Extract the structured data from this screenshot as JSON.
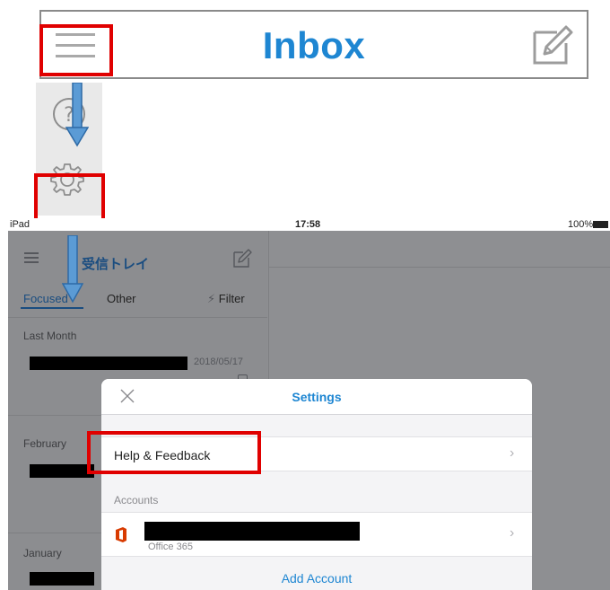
{
  "zoomed_header": {
    "title": "Inbox"
  },
  "ipad": {
    "status": {
      "device": "iPad",
      "time": "17:58",
      "battery": "100%"
    },
    "mail_list": {
      "title": "受信トレイ",
      "tabs": [
        {
          "label": "Focused"
        },
        {
          "label": "Other"
        }
      ],
      "filter_label": "Filter",
      "sections": [
        {
          "label": "Last Month",
          "date": "2018/05/17"
        },
        {
          "label": "February"
        },
        {
          "label": "January"
        }
      ]
    },
    "settings": {
      "title": "Settings",
      "help_label": "Help & Feedback",
      "accounts_header": "Accounts",
      "account_type": "Office 365",
      "add_account_label": "Add Account"
    }
  },
  "colors": {
    "accent_blue": "#1e86d2",
    "highlight_red": "#e00000",
    "arrow_blue": "#3f86c8",
    "office_red": "#d83b01"
  },
  "icons": [
    "hamburger-icon",
    "compose-icon",
    "help-icon",
    "gear-icon",
    "close-icon",
    "chevron-right-icon",
    "office-icon",
    "filter-icon",
    "arrow-down-icon"
  ]
}
